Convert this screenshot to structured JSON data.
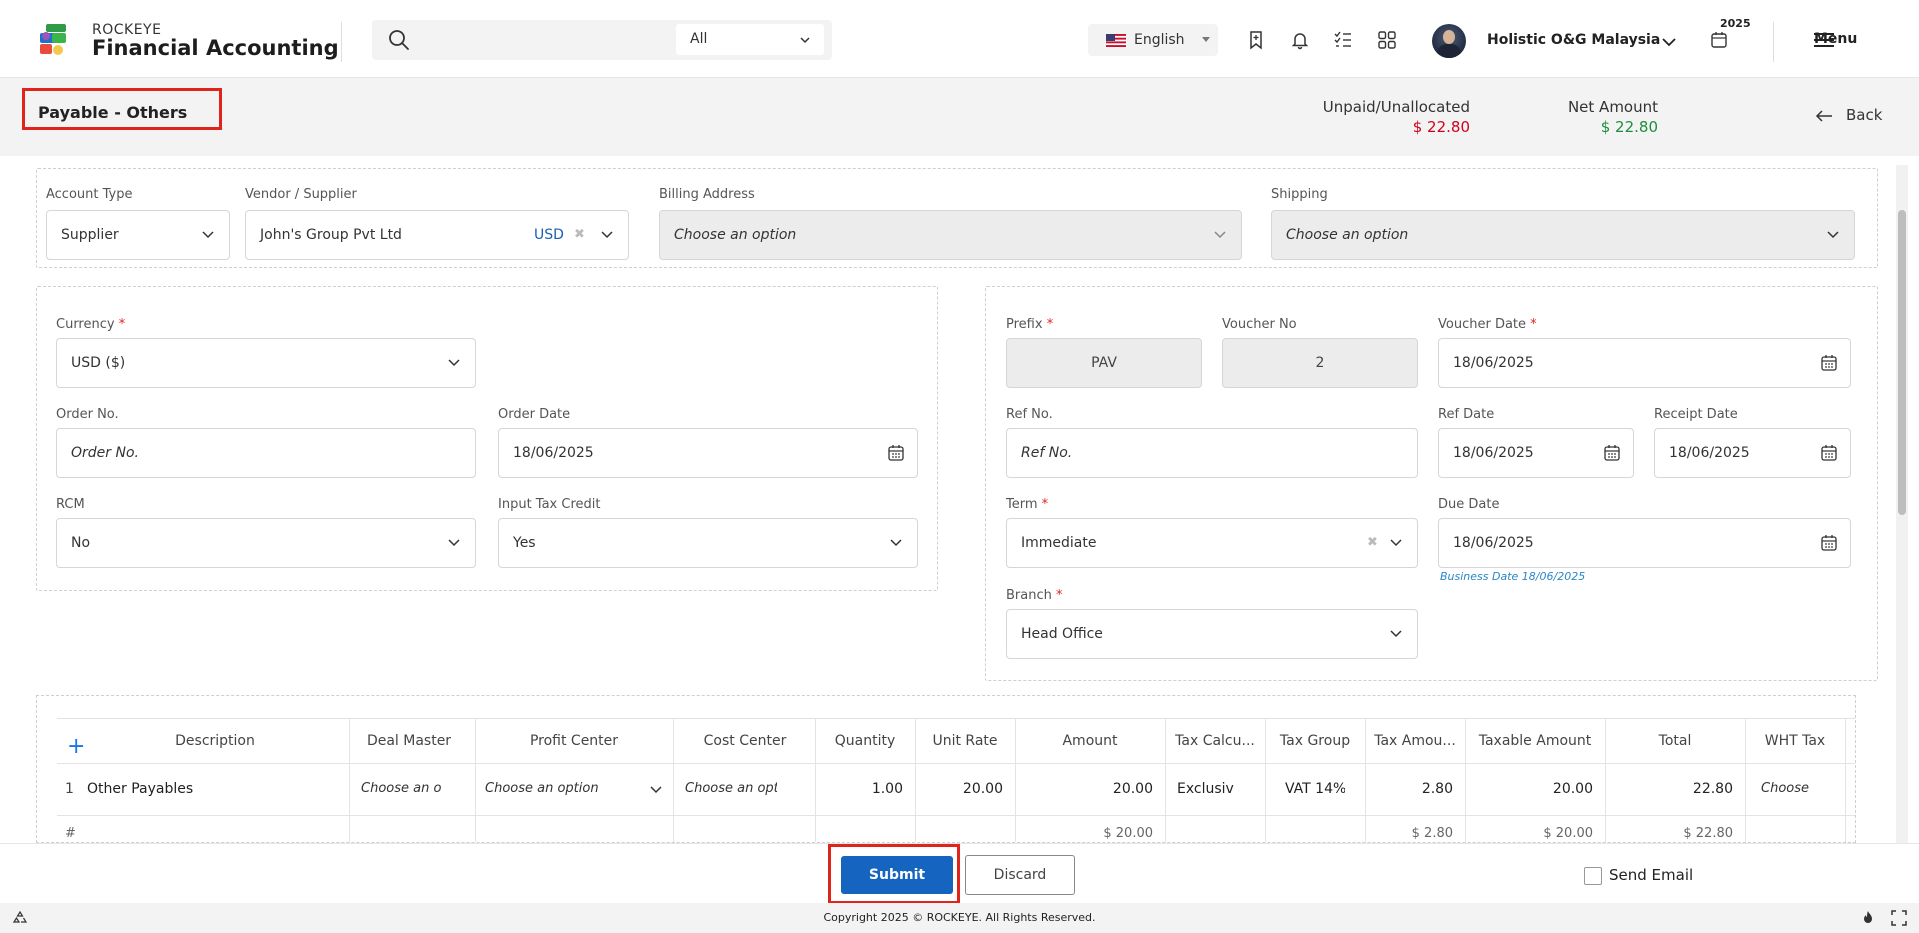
{
  "header": {
    "brand_small": "ROCKEYE",
    "brand_big": "Financial Accounting",
    "search_filter": "All",
    "language": "English",
    "company": "Holistic O&G Malaysia",
    "year": "2025",
    "menu_label": "Menu"
  },
  "subheader": {
    "title": "Payable - Others",
    "unpaid_label": "Unpaid/Unallocated",
    "unpaid_value": "$ 22.80",
    "net_label": "Net Amount",
    "net_value": "$ 22.80",
    "back_label": "Back",
    "colors": {
      "unpaid": "#d0021b",
      "net": "#1e8e3e"
    }
  },
  "party": {
    "account_type_label": "Account Type",
    "account_type_value": "Supplier",
    "vendor_label": "Vendor / Supplier",
    "vendor_value": "John's Group Pvt Ltd",
    "vendor_currency": "USD",
    "billing_label": "Billing Address",
    "billing_placeholder": "Choose an option",
    "shipping_label": "Shipping",
    "shipping_placeholder": "Choose an option"
  },
  "left_form": {
    "currency_label": "Currency",
    "currency_value": "USD ($)",
    "order_no_label": "Order No.",
    "order_no_placeholder": "Order No.",
    "order_date_label": "Order Date",
    "order_date_value": "18/06/2025",
    "rcm_label": "RCM",
    "rcm_value": "No",
    "itc_label": "Input Tax Credit",
    "itc_value": "Yes"
  },
  "right_form": {
    "prefix_label": "Prefix",
    "prefix_value": "PAV",
    "voucher_no_label": "Voucher No",
    "voucher_no_value": "2",
    "voucher_date_label": "Voucher Date",
    "voucher_date_value": "18/06/2025",
    "ref_no_label": "Ref No.",
    "ref_no_placeholder": "Ref No.",
    "ref_date_label": "Ref Date",
    "ref_date_value": "18/06/2025",
    "receipt_date_label": "Receipt Date",
    "receipt_date_value": "18/06/2025",
    "term_label": "Term",
    "term_value": "Immediate",
    "due_date_label": "Due Date",
    "due_date_value": "18/06/2025",
    "business_date": "Business Date 18/06/2025",
    "branch_label": "Branch",
    "branch_value": "Head Office"
  },
  "table": {
    "columns": [
      "Description",
      "Deal Master",
      "Profit Center",
      "Cost Center",
      "Quantity",
      "Unit Rate",
      "Amount",
      "Tax Calcu...",
      "Tax Group",
      "Tax Amou...",
      "Taxable Amount",
      "Total",
      "WHT Tax"
    ],
    "row": {
      "index": "1",
      "description": "Other Payables",
      "deal_master": "Choose an o",
      "profit_center": "Choose an option",
      "cost_center": "Choose an opti",
      "quantity": "1.00",
      "unit_rate": "20.00",
      "amount": "20.00",
      "tax_calc": "Exclusiv",
      "tax_group": "VAT 14%",
      "tax_amount": "2.80",
      "taxable_amount": "20.00",
      "total": "22.80",
      "wht_tax": "Choose"
    },
    "footer": {
      "hash": "#",
      "amount": "$ 20.00",
      "tax_amount": "$ 2.80",
      "taxable_amount": "$ 20.00",
      "total": "$ 22.80"
    }
  },
  "actions": {
    "submit_label": "Submit",
    "discard_label": "Discard",
    "send_email_label": "Send Email"
  },
  "footer": {
    "copyright": "Copyright 2025 © ROCKEYE. All Rights Reserved."
  }
}
